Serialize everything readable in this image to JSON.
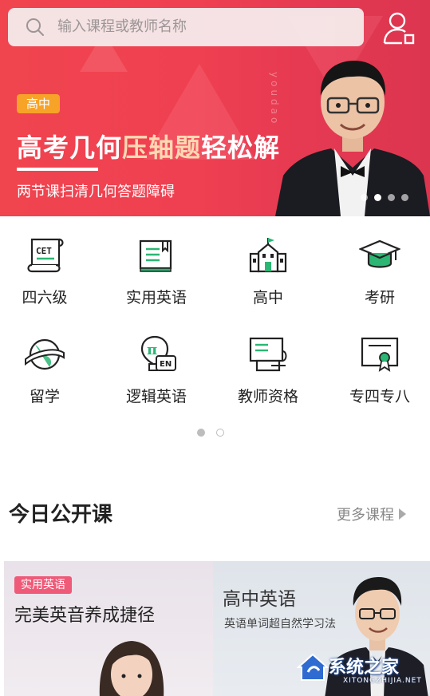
{
  "search": {
    "placeholder": "输入课程或教师名称"
  },
  "banner": {
    "tag": "高中",
    "headline_part1": "高考几何",
    "headline_part2": "压轴题",
    "headline_part3": "轻松解",
    "subhead": "两节课扫清几何答题障碍",
    "watermark": "youdao",
    "slide_count": 4,
    "active_slide": 1
  },
  "categories": [
    {
      "label": "四六级",
      "icon": "cet-scroll-icon"
    },
    {
      "label": "实用英语",
      "icon": "book-icon"
    },
    {
      "label": "高中",
      "icon": "school-building-icon"
    },
    {
      "label": "考研",
      "icon": "graduation-cap-icon"
    },
    {
      "label": "留学",
      "icon": "globe-icon"
    },
    {
      "label": "逻辑英语",
      "icon": "lightbulb-pi-icon"
    },
    {
      "label": "教师资格",
      "icon": "presentation-board-icon"
    },
    {
      "label": "专四专八",
      "icon": "certificate-icon"
    }
  ],
  "grid_pager": {
    "pages": 2,
    "active": 0
  },
  "section": {
    "title": "今日公开课",
    "more": "更多课程"
  },
  "courses": [
    {
      "tag": "实用英语",
      "title": "完美英音养成捷径"
    },
    {
      "title": "高中英语",
      "subtitle": "英语单词超自然学习法"
    }
  ],
  "watermark_logo": {
    "brand": "系统之家",
    "url": "XITONGZHIJIA.NET"
  },
  "colors": {
    "accent": "#ef4051",
    "tag_orange": "#f7a328",
    "icon_green": "#2bb673",
    "course_tag": "#ef5a78"
  }
}
